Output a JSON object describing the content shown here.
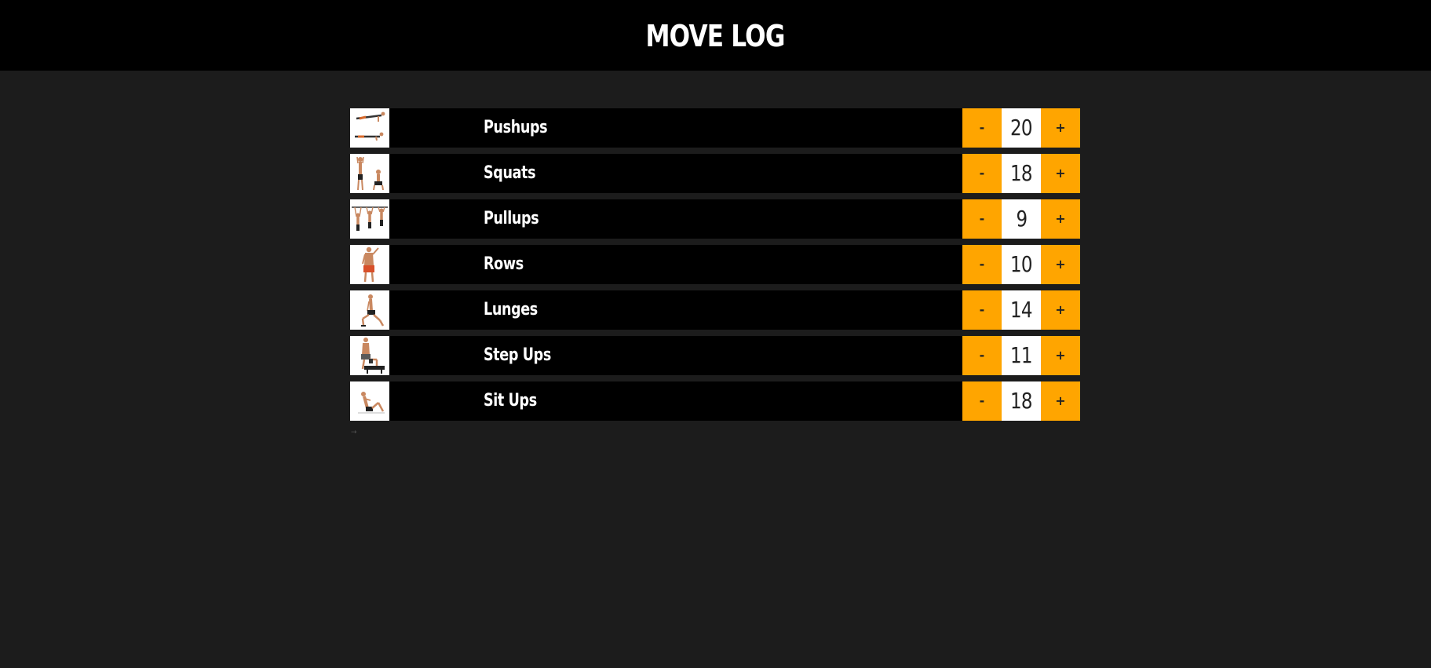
{
  "header": {
    "title": "MOVE LOG"
  },
  "exercises": [
    {
      "name": "Pushups",
      "count": "20",
      "minus": "-",
      "plus": "+"
    },
    {
      "name": "Squats",
      "count": "18",
      "minus": "-",
      "plus": "+"
    },
    {
      "name": "Pullups",
      "count": "9",
      "minus": "-",
      "plus": "+"
    },
    {
      "name": "Rows",
      "count": "10",
      "minus": "-",
      "plus": "+"
    },
    {
      "name": "Lunges",
      "count": "14",
      "minus": "-",
      "plus": "+"
    },
    {
      "name": "Step Ups",
      "count": "11",
      "minus": "-",
      "plus": "+"
    },
    {
      "name": "Sit Ups",
      "count": "18",
      "minus": "-",
      "plus": "+"
    }
  ],
  "footer": {
    "mark": "→"
  },
  "colors": {
    "background": "#1c1c1c",
    "header": "#000000",
    "row": "#000000",
    "accent": "#ffa500",
    "counter_bg": "#ffffff"
  }
}
